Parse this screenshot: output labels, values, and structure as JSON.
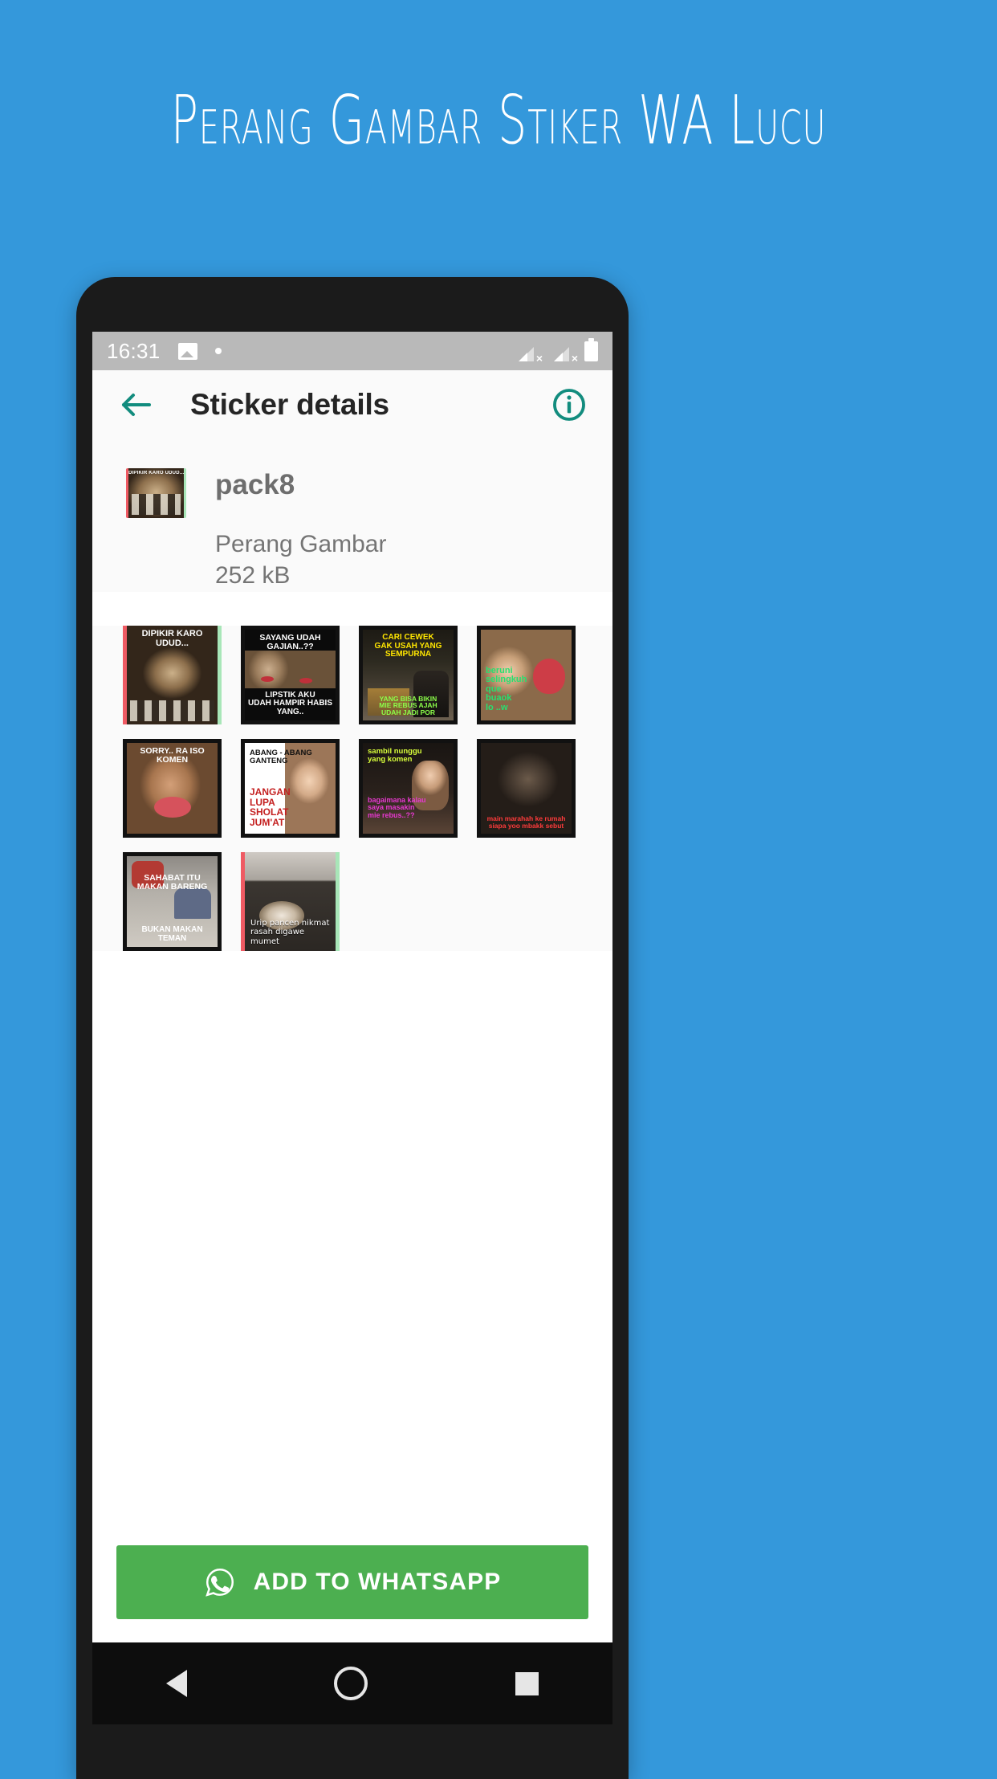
{
  "promo": {
    "headline": "Perang Gambar Stiker WA Lucu",
    "background_color": "#3498DB",
    "text_color": "#FFFFFF"
  },
  "status_bar": {
    "clock": "16:31",
    "left_icons": [
      "image-icon",
      "dot-icon"
    ],
    "right_icons": [
      "signal-no-sim-icon",
      "signal-no-sim-icon",
      "battery-icon"
    ],
    "background_color": "#B9B9B9"
  },
  "app_bar": {
    "back_icon": "arrow-back-icon",
    "title": "Sticker details",
    "info_icon": "info-circle-icon",
    "accent_color": "#128C7E"
  },
  "pack_header": {
    "tray_caption": "DIPIKIR KARO UDUD...",
    "name": "pack8",
    "publisher": "Perang Gambar",
    "size": "252 kB"
  },
  "stickers": [
    {
      "id": 1,
      "caption_top": "DIPIKIR KARO UDUD...",
      "caption_bottom": "",
      "frame": "split",
      "art": "art-wizard"
    },
    {
      "id": 2,
      "caption_top": "SAYANG UDAH GAJIAN..??",
      "caption_bottom": "LIPSTIK AKU\nUDAH HAMPIR HABIS YANG..",
      "frame": "dark",
      "art": "art-monkeys"
    },
    {
      "id": 3,
      "caption_top": "CARI CEWEK\nGAK USAH YANG\nSEMPURNA",
      "caption_bottom": "YANG BISA BIKIN\nMIE REBUS AJAH\nUDAH JADI POR",
      "frame": "dark",
      "art": "art-warung"
    },
    {
      "id": 4,
      "caption_top": "",
      "caption_bottom": "beruni\nselingkuh\nque\nbuaok\nlo ..w",
      "frame": "dark",
      "art": "art-kids"
    },
    {
      "id": 5,
      "caption_top": "SORRY.. RA ISO KOMEN",
      "caption_bottom": "",
      "frame": "dark",
      "art": "art-lips"
    },
    {
      "id": 6,
      "caption_top": "ABANG - ABANG\nGANTENG",
      "caption_bottom": "JANGAN\nLUPA\nSHOLAT\nJUM'AT",
      "frame": "dark",
      "art": "art-ganteng"
    },
    {
      "id": 7,
      "caption_top": "sambil nunggu\nyang komen",
      "caption_bottom": "bagaimana kalau\nsaya masakin\nmie rebus..??",
      "frame": "dark",
      "art": "art-mie"
    },
    {
      "id": 8,
      "caption_top": "",
      "caption_bottom": "main marahah ke rumah\nsiapa yoo mbakk sebut",
      "frame": "dark",
      "art": "art-couple"
    },
    {
      "id": 9,
      "caption_top": "SAHABAT ITU\nMAKAN BARENG",
      "caption_bottom": "BUKAN MAKAN TEMAN",
      "frame": "dark",
      "art": "art-sahabat"
    },
    {
      "id": 10,
      "caption_top": "",
      "caption_bottom": "Urip pancen nikmat\nrasah digawe mumet",
      "frame": "split",
      "art": "art-cat"
    }
  ],
  "add_button": {
    "label": "ADD TO WHATSAPP",
    "icon": "whatsapp-icon",
    "color": "#4CAF50"
  },
  "nav_bar": {
    "items": [
      "back-triangle-icon",
      "home-circle-icon",
      "recents-square-icon"
    ]
  }
}
